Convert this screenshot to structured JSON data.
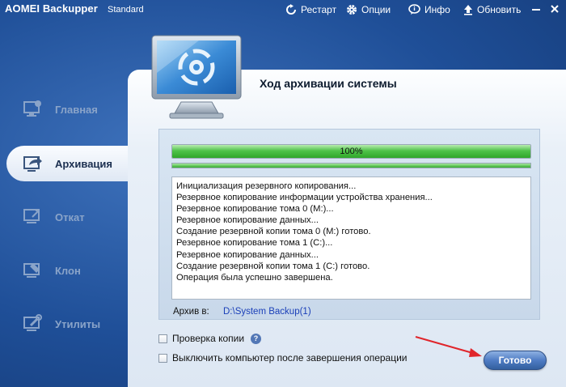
{
  "app": {
    "title": "AOMEI Backupper",
    "edition": "Standard"
  },
  "toolbar": {
    "restart_label": "Рестарт",
    "options_label": "Опции",
    "info_label": "Инфо",
    "update_label": "Обновить"
  },
  "sidebar": {
    "items": [
      {
        "label": "Главная",
        "icon": "home-icon"
      },
      {
        "label": "Архивация",
        "icon": "backup-icon",
        "active": true
      },
      {
        "label": "Откат",
        "icon": "restore-icon"
      },
      {
        "label": "Клон",
        "icon": "clone-icon"
      },
      {
        "label": "Утилиты",
        "icon": "utilities-icon"
      }
    ]
  },
  "main": {
    "title": "Ход архивации системы",
    "progress": {
      "value": 1.0,
      "label": "100%",
      "secondary_value": 1.0
    },
    "log": [
      "Инициализация резервного копирования...",
      "Резервное копирование информации устройства хранения...",
      "Резервное копирование тома 0 (M:)...",
      "Резервное копирование данных...",
      "Создание резервной копии тома 0 (M:) готово.",
      "Резервное копирование тома 1 (C:)...",
      "Резервное копирование данных...",
      "Создание резервной копии тома 1 (C:) готово.",
      "Операция была успешно завершена."
    ],
    "archive_label": "Архив в:",
    "archive_path": "D:\\System Backup(1)",
    "verify_label": "Проверка копии",
    "shutdown_label": "Выключить компьютер после завершения операции",
    "done_label": "Готово"
  },
  "colors": {
    "accent": "#2a5aa8",
    "progress": "#3fb43a",
    "annotation": "#e0252b"
  }
}
